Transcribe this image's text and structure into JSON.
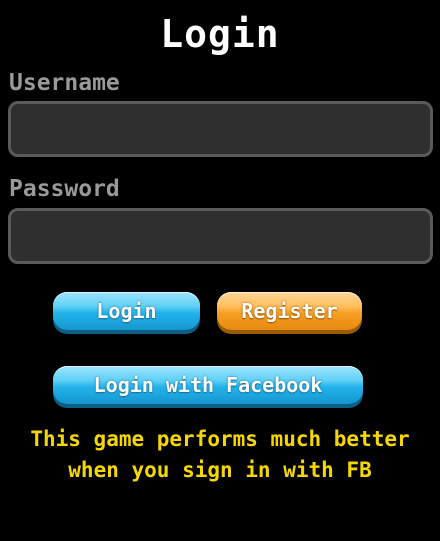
{
  "login_screen": {
    "title": "Login",
    "username": {
      "label": "Username",
      "value": "",
      "placeholder": ""
    },
    "password": {
      "label": "Password",
      "value": "",
      "placeholder": ""
    },
    "buttons": {
      "login": "Login",
      "register": "Register",
      "facebook": "Login with Facebook"
    },
    "notice": "This game performs much better when you sign in with FB"
  },
  "colors": {
    "background": "#000000",
    "title": "#ffffff",
    "label": "#9a9a9a",
    "field_fill": "#2f2f2f",
    "field_border": "#5a5a5a",
    "button_blue": "#23b3ea",
    "button_orange": "#f7a026",
    "notice": "#f6d800"
  }
}
